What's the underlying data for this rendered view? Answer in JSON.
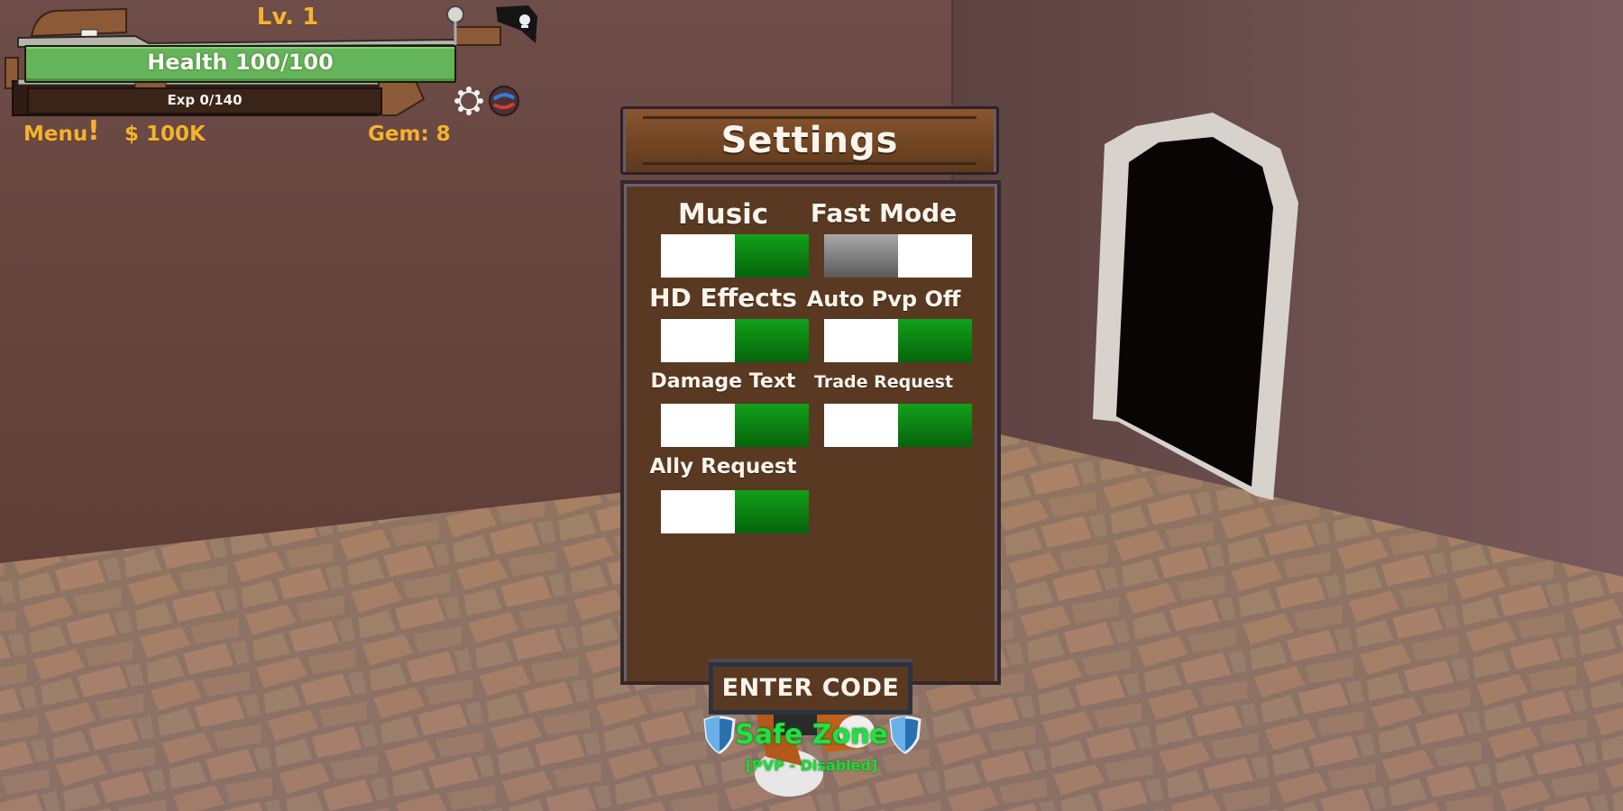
{
  "hud": {
    "level": "Lv. 1",
    "health_text": "Health 100/100",
    "health_fraction": 1.0,
    "exp_text": "Exp 0/140",
    "exp_fraction": 0.0,
    "menu_label": "Menu",
    "menu_alert": "!",
    "money": "$ 100K",
    "gems": "Gem: 8",
    "icons": [
      "pirate-flag-icon",
      "gear-icon",
      "globe-icon"
    ]
  },
  "settings": {
    "title": "Settings",
    "options": [
      {
        "label": "Music",
        "state": "on"
      },
      {
        "label": "Fast Mode",
        "state": "off"
      },
      {
        "label": "HD Effects",
        "state": "on"
      },
      {
        "label": "Auto Pvp Off",
        "state": "on"
      },
      {
        "label": "Damage Text",
        "state": "on"
      },
      {
        "label": "Trade Request",
        "state": "on"
      },
      {
        "label": "Ally Request",
        "state": "on"
      }
    ],
    "enter_code_label": "ENTER CODE"
  },
  "zone": {
    "name": "Safe Zone",
    "status": "[PVP - Disabled]"
  },
  "colors": {
    "toggle_on": "#0a8a12",
    "toggle_off": "#7a7a7a",
    "panel": "#5a3922",
    "hud_gold": "#f3b330",
    "health_green": "#64b45a",
    "safe_zone_green": "#22e042"
  }
}
